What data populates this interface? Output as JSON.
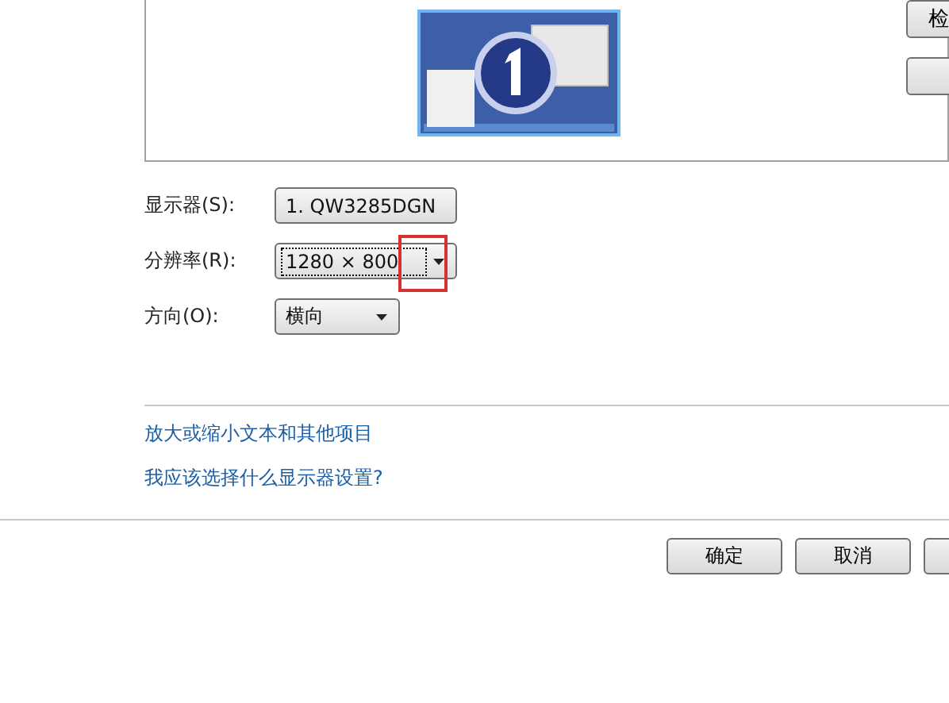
{
  "side_buttons": [
    {
      "kind": "text",
      "label": "检"
    },
    {
      "kind": "blank"
    }
  ],
  "settings": [
    {
      "label": "显示器(S):",
      "value": "1. QW3285DGN",
      "focused": false,
      "highlighted": false,
      "wide": true
    },
    {
      "label": "分辨率(R):",
      "value": "1280 × 800",
      "focused": true,
      "highlighted": true,
      "wide": true
    },
    {
      "label": "方向(O):",
      "value": "横向",
      "focused": false,
      "highlighted": false,
      "wide": false
    }
  ],
  "links": [
    "放大或缩小文本和其他项目",
    "我应该选择什么显示器设置?"
  ],
  "buttons": [
    {
      "kind": "text",
      "label": "确定"
    },
    {
      "kind": "text",
      "label": "取消"
    },
    {
      "kind": "blank"
    }
  ]
}
